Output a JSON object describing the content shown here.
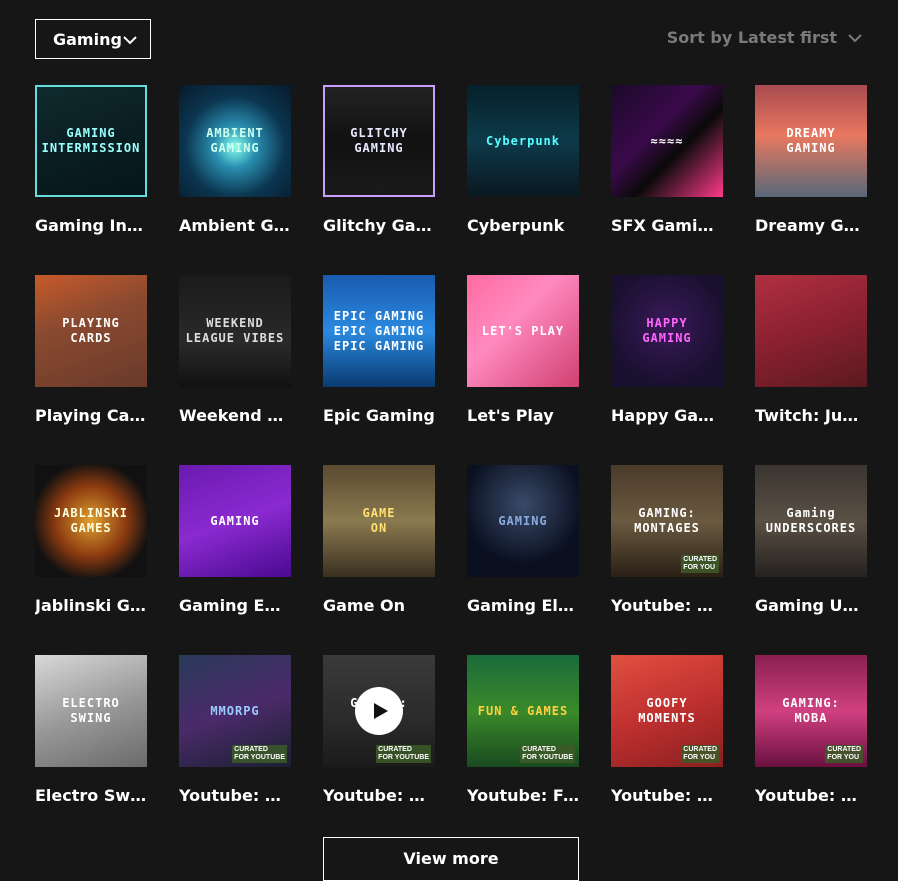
{
  "filter": {
    "label": "Gaming"
  },
  "sort": {
    "label": "Sort by Latest first"
  },
  "cards": [
    {
      "title": "Gaming Inte…",
      "art": "GAMING\nINTERMISSION",
      "bg": "linear-gradient(160deg,#0f2a2e,#061418)",
      "fg": "#9ff",
      "border": "#6dd"
    },
    {
      "title": "Ambient Ga…",
      "art": "AMBIENT GAMING",
      "bg": "radial-gradient(circle at 50% 55%,#8fe 0%,#2a8fb0 25%,#0b3550 60%,#061a2a 100%)",
      "fg": "#cfe"
    },
    {
      "title": "Glitchy Gami…",
      "art": "GLITCHY\nGAMING",
      "bg": "linear-gradient(180deg,#222,#111 50%,#1a1a1a)",
      "fg": "#e8e8ff",
      "border": "#c9a0ff"
    },
    {
      "title": "Cyberpunk",
      "art": "Cyberpunk",
      "bg": "linear-gradient(180deg,#06202a,#0d3a4a 50%,#0a1820)",
      "fg": "#5ff"
    },
    {
      "title": "SFX Gaming …",
      "art": "≈≈≈≈",
      "bg": "linear-gradient(135deg,#1b0a2a,#3a0a4a 40%,#0a0a0a 60%,#ff3a8a)",
      "fg": "#fff"
    },
    {
      "title": "Dreamy Gam…",
      "art": "DREAMY\nGAMING",
      "bg": "linear-gradient(180deg,#a84a50,#e87860 45%,#586878 100%)",
      "fg": "#fff"
    },
    {
      "title": "Playing Cards",
      "art": "PLAYING\nCARDS",
      "bg": "linear-gradient(160deg,#c75a2a,#8a4a30 40%,#6a3a2a)",
      "fg": "#fff"
    },
    {
      "title": "Weekend Le…",
      "art": "WEEKEND\nLEAGUE VIBES",
      "bg": "linear-gradient(180deg,#1a1a1a,#2a2a2a 60%,#111)",
      "fg": "#ddd"
    },
    {
      "title": "Epic Gaming",
      "art": "EPIC GAMING\nEPIC GAMING\nEPIC GAMING",
      "bg": "linear-gradient(180deg,#1a5ab0,#2a8ae0 50%,#0a3a70)",
      "fg": "#fff"
    },
    {
      "title": "Let's Play",
      "art": "LET'S PLAY",
      "bg": "linear-gradient(135deg,#ff6aa0,#ff8ac0 40%,#d04070 100%)",
      "fg": "#fff"
    },
    {
      "title": "Happy Gami…",
      "art": "HAPPY\nGAMING",
      "bg": "radial-gradient(circle at 50% 45%,#3a1a5a,#1a1030 70%)",
      "fg": "#f6f"
    },
    {
      "title": "Twitch: Just …",
      "art": "",
      "bg": "linear-gradient(160deg,#b03040,#8a2030 50%,#5a1a20)",
      "fg": "#fff"
    },
    {
      "title": "Jablinski Ga…",
      "art": "JABLINSKI\nGAMES",
      "bg": "radial-gradient(circle at 50% 50%,#e0a030,#8a3a10 45%,#111 75%)",
      "fg": "#ffd"
    },
    {
      "title": "Gaming EDM…",
      "art": "GAMING",
      "bg": "linear-gradient(160deg,#6a1ab0,#8a2ad0 50%,#4a0a90)",
      "fg": "#fff"
    },
    {
      "title": "Game On",
      "art": "GAME\nON",
      "bg": "linear-gradient(180deg,#5a4a30,#8a7a50 50%,#3a3020)",
      "fg": "#ffe070"
    },
    {
      "title": "Gaming Elec…",
      "art": "GAMING",
      "bg": "radial-gradient(circle at 50% 35%,#3a4a6a,#0a1020 65%)",
      "fg": "#8ad"
    },
    {
      "title": "Youtube: Ga…",
      "art": "GAMING:\nMONTAGES",
      "bg": "linear-gradient(180deg,#4a3a2a,#6a5a40 50%,#2a2015)",
      "fg": "#fff",
      "curated": "CURATED\nFOR YOU"
    },
    {
      "title": "Gaming Und…",
      "art": "Gaming\nUNDERSCORES",
      "bg": "linear-gradient(180deg,#3a3530,#5a5045 50%,#252220)",
      "fg": "#fff"
    },
    {
      "title": "Electro Swing",
      "art": "ELECTRO\nSWING",
      "bg": "linear-gradient(160deg,#d8d8d8,#9a9a9a 50%,#6a6a6a)",
      "fg": "#fff"
    },
    {
      "title": "Youtube: M…",
      "art": "MMORPG",
      "bg": "linear-gradient(160deg,#2a3a5a,#4a2a6a 50%,#1a2030)",
      "fg": "#9cf",
      "curated": "CURATED\nFOR YOUTUBE"
    },
    {
      "title": "Youtube: FPS",
      "art": "GAMING:\nFPS",
      "bg": "linear-gradient(180deg,#3a3a3a,#2a2a2a 60%,#1a1a1a)",
      "fg": "#fff",
      "curated": "CURATED\nFOR YOUTUBE",
      "play": true
    },
    {
      "title": "Youtube: Fu…",
      "art": "FUN & GAMES",
      "bg": "linear-gradient(180deg,#1a6a3a,#3a8a2a 50%,#1a4a20)",
      "fg": "#ffd040",
      "curated": "CURATED\nFOR YOUTUBE"
    },
    {
      "title": "Youtube: Go…",
      "art": "GOOFY\nMOMENTS",
      "bg": "linear-gradient(160deg,#e05040,#c03030 50%,#8a2020)",
      "fg": "#fff",
      "curated": "CURATED\nFOR YOU"
    },
    {
      "title": "Youtube: M…",
      "art": "GAMING:\nMOBA",
      "bg": "linear-gradient(180deg,#8a2050,#d04080 50%,#6a1040)",
      "fg": "#fff",
      "curated": "CURATED\nFOR YOU"
    }
  ],
  "view_more": {
    "label": "View more"
  },
  "icons": {
    "chevron": "chevron-down-icon",
    "play": "play-icon"
  }
}
